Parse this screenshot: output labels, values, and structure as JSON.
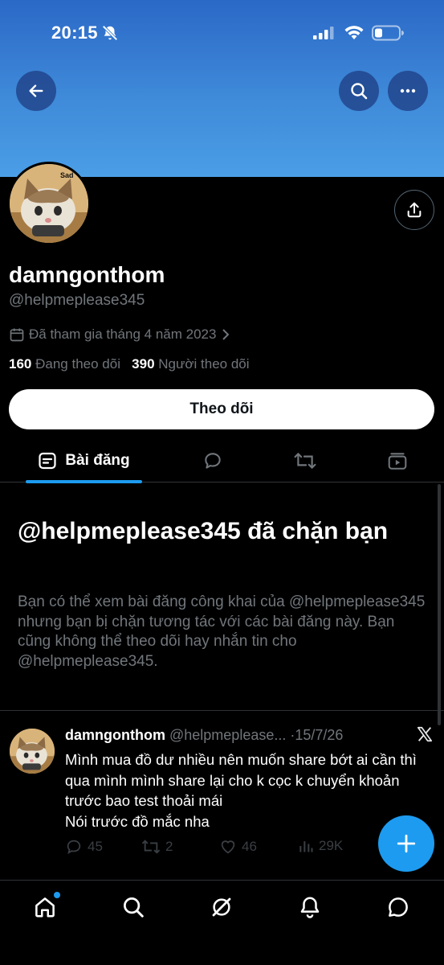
{
  "status_bar": {
    "time": "20:15"
  },
  "header": {
    "icons": [
      "back-arrow-icon",
      "search-icon",
      "more-horizontal-icon"
    ]
  },
  "profile": {
    "display_name": "damngonthom",
    "handle": "@helpmeplease345",
    "avatar_caption": "Sad",
    "joined": "Đã tham gia tháng 4 năm 2023",
    "following_count": "160",
    "following_label": "Đang theo dõi",
    "followers_count": "390",
    "followers_label": "Người theo dõi",
    "follow_button": "Theo dõi"
  },
  "tabs": {
    "posts_label": "Bài đăng",
    "icons": [
      "posts-icon",
      "replies-icon",
      "reposts-icon",
      "media-icon"
    ]
  },
  "blocked_notice": {
    "title": "@helpmeplease345 đã chặn bạn",
    "body": "Bạn có thể xem bài đăng công khai của @helpmeplease345 nhưng bạn bị chặn tương tác với các bài đăng này. Bạn cũng không thể theo dõi hay nhắn tin cho @helpmeplease345."
  },
  "post": {
    "name": "damngonthom",
    "handle": "@helpmeplease...",
    "separator": "·",
    "date": "15/7/26",
    "text_line1": "Mình mua đồ dư nhiều nên muốn share bớt ai cần thì qua mình mình share lại cho k cọc k chuyển khoản trước bao test thoải mái",
    "text_line2": "Nói trước đồ mắc nha",
    "replies": "45",
    "reposts": "2",
    "likes": "46",
    "views": "29K"
  },
  "colors": {
    "accent": "#1d9bf0",
    "banner": "#3f8ad9",
    "muted_text": "#71767b",
    "divider": "#2f3336"
  }
}
